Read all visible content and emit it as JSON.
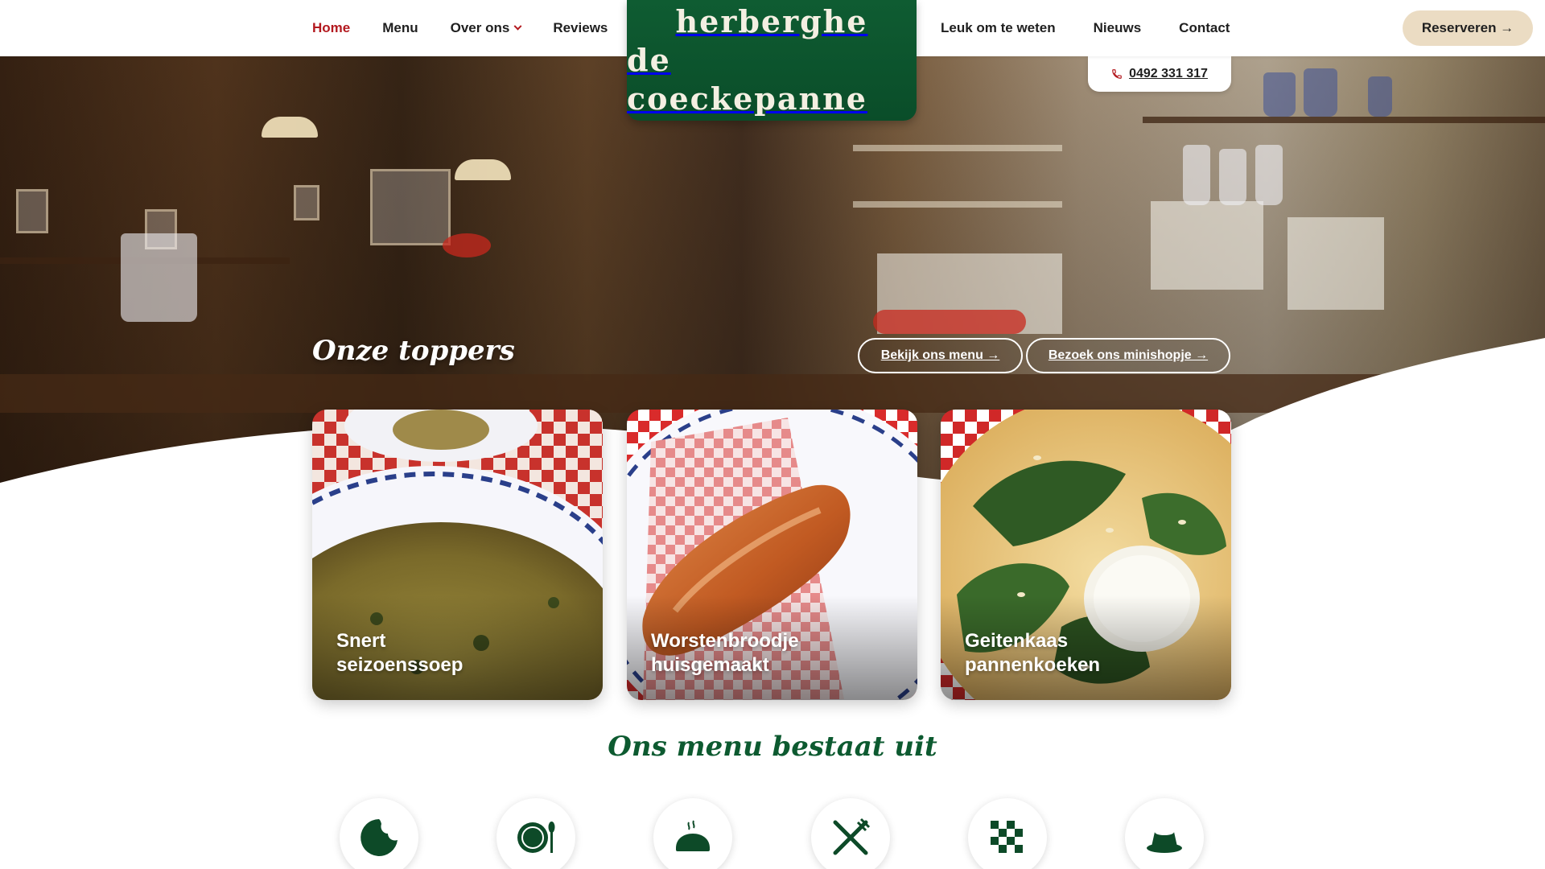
{
  "nav": {
    "left": [
      {
        "label": "Home",
        "active": true
      },
      {
        "label": "Menu"
      },
      {
        "label": "Over ons",
        "dropdown": true
      },
      {
        "label": "Reviews"
      }
    ],
    "right": [
      {
        "label": "Leuk om te weten"
      },
      {
        "label": "Nieuws"
      },
      {
        "label": "Contact"
      }
    ],
    "reserve_label": "Reserveren →"
  },
  "logo": {
    "line1": "herberghe",
    "line2": "de coeckepanne"
  },
  "phone": {
    "number": "0492 331 317",
    "icon": "phone-icon"
  },
  "hero": {
    "title": "Onze toppers",
    "buttons": [
      "Bekijk ons menu →",
      "Bezoek ons minishopje →"
    ]
  },
  "cards": [
    {
      "line1": "Snert",
      "line2": "seizoenssoep"
    },
    {
      "line1": "Worstenbroodje",
      "line2": "huisgemaakt"
    },
    {
      "line1": "Geitenkaas",
      "line2": "pannenkoeken"
    }
  ],
  "menu_section": {
    "title": "Ons menu bestaat uit",
    "icons": [
      "cookie-icon",
      "plate-icon",
      "bread-icon",
      "cutlery-icon",
      "checker-icon",
      "pudding-icon"
    ]
  },
  "colors": {
    "brand_green": "#0d5a30",
    "active_red": "#b3191f",
    "reserve_bg": "#ebdcc3"
  }
}
